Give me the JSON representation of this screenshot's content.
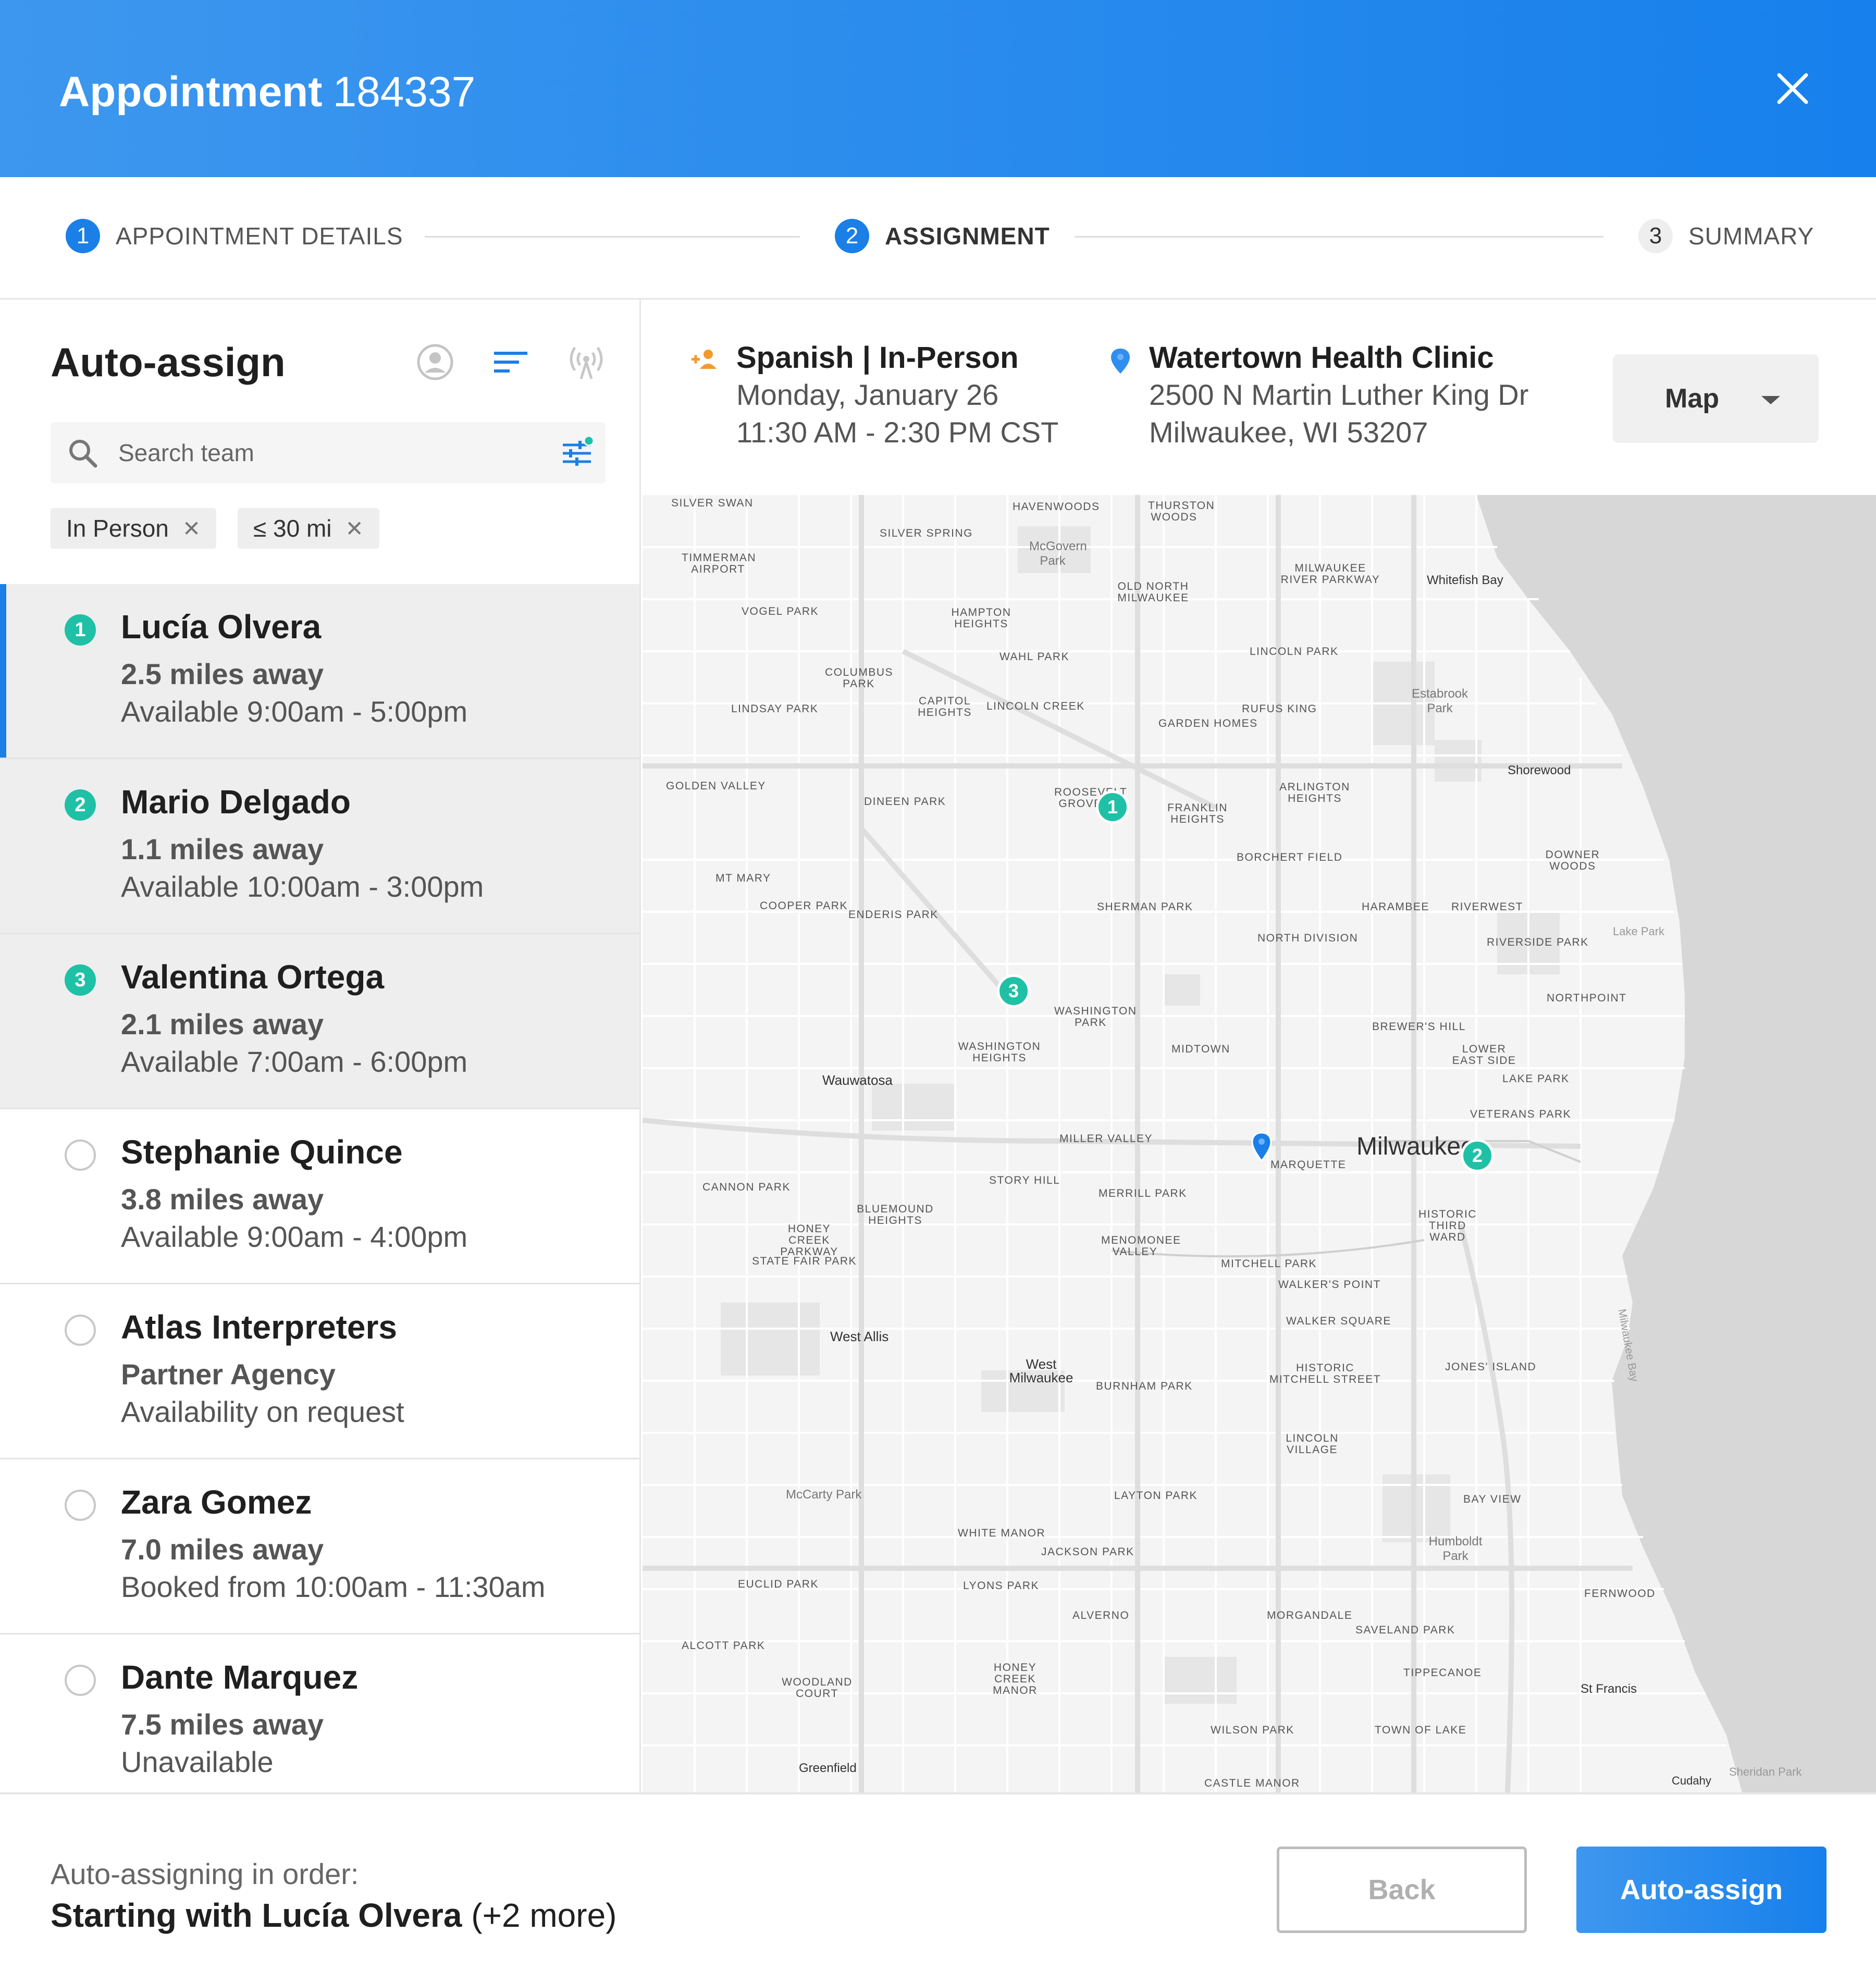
{
  "header": {
    "title_bold": "Appointment",
    "title_number": "184337",
    "close_icon": "close-icon"
  },
  "stepper": {
    "steps": [
      {
        "num": "1",
        "label": "APPOINTMENT DETAILS",
        "state": "done"
      },
      {
        "num": "2",
        "label": "ASSIGNMENT",
        "state": "active"
      },
      {
        "num": "3",
        "label": "SUMMARY",
        "state": "upcoming"
      }
    ]
  },
  "left": {
    "title": "Auto-assign",
    "tools": [
      "person-circle-icon",
      "sort-lines-icon",
      "broadcast-icon"
    ],
    "search": {
      "placeholder": "Search team",
      "value": ""
    },
    "filters": [
      {
        "label": "In Person"
      },
      {
        "label": "≤ 30 mi"
      }
    ],
    "list": [
      {
        "rank": "1",
        "name": "Lucía Olvera",
        "distance": "2.5 miles away",
        "availability": "Available 9:00am - 5:00pm",
        "selected": true
      },
      {
        "rank": "2",
        "name": "Mario Delgado",
        "distance": "1.1 miles away",
        "availability": "Available 10:00am - 3:00pm",
        "selected": true
      },
      {
        "rank": "3",
        "name": "Valentina Ortega",
        "distance": "2.1 miles away",
        "availability": "Available 7:00am - 6:00pm",
        "selected": true
      },
      {
        "rank": "",
        "name": "Stephanie Quince",
        "distance": "3.8 miles away",
        "availability": "Available 9:00am - 4:00pm",
        "selected": false
      },
      {
        "rank": "",
        "name": "Atlas Interpreters",
        "distance": "Partner Agency",
        "availability": "Availability on request",
        "selected": false
      },
      {
        "rank": "",
        "name": "Zara Gomez",
        "distance": "7.0 miles away",
        "availability": "Booked from 10:00am - 11:30am",
        "selected": false
      },
      {
        "rank": "",
        "name": "Dante Marquez",
        "distance": "7.5 miles away",
        "availability": "Unavailable",
        "selected": false
      }
    ]
  },
  "info": {
    "language": "Spanish | In-Person",
    "date": "Monday,  January 26",
    "time": "11:30 AM - 2:30 PM CST",
    "clinic": "Watertown Health Clinic",
    "address1": "2500 N Martin Luther King Dr",
    "address2": "Milwaukee, WI 53207",
    "view_select": "Map"
  },
  "map": {
    "neighborhoods": [
      "SILVER SWAN",
      "SILVER SPRING",
      "HAVENWOODS",
      "THURSTON WOODS",
      "TIMMERMAN AIRPORT",
      "McGovern Park",
      "OLD NORTH MILWAUKEE",
      "MILWAUKEE RIVER PARKWAY",
      "Whitefish Bay",
      "VOGEL PARK",
      "HAMPTON HEIGHTS",
      "LINCOLN PARK",
      "WAHL PARK",
      "COLUMBUS PARK",
      "CAPITOL HEIGHTS",
      "LINCOLN CREEK",
      "LINDSAY PARK",
      "RUFUS KING",
      "GARDEN HOMES",
      "Estabrook Park",
      "Shorewood",
      "GOLDEN VALLEY",
      "DINEEN PARK",
      "ROOSEVELT GROVE",
      "FRANKLIN HEIGHTS",
      "ARLINGTON HEIGHTS",
      "BORCHERT FIELD",
      "DOWNER WOODS",
      "MT MARY",
      "COOPER PARK",
      "ENDERIS PARK",
      "SHERMAN PARK",
      "HARAMBEE",
      "RIVERWEST",
      "NORTH DIVISION",
      "RIVERSIDE PARK",
      "Lake Park",
      "NORTHPOINT",
      "WASHINGTON PARK",
      "BREWER'S HILL",
      "WASHINGTON HEIGHTS",
      "MIDTOWN",
      "LOWER EAST SIDE",
      "LAKE PARK",
      "Wauwatosa",
      "VETERANS PARK",
      "MILLER VALLEY",
      "MARQUETTE",
      "Milwaukee",
      "CANNON PARK",
      "STORY HILL",
      "MERRILL PARK",
      "HISTORIC THIRD WARD",
      "BLUEMOUND HEIGHTS",
      "HONEY CREEK PARKWAY",
      "MENOMONEE VALLEY",
      "STATE FAIR PARK",
      "MITCHELL PARK",
      "WALKER'S POINT",
      "West Allis",
      "WALKER SQUARE",
      "West Milwaukee",
      "BURNHAM PARK",
      "HISTORIC MITCHELL STREET",
      "JONES' ISLAND",
      "Milwaukee Bay",
      "LINCOLN VILLAGE",
      "McCarty Park",
      "LAYTON PARK",
      "BAY VIEW",
      "WHITE MANOR",
      "JACKSON PARK",
      "Humboldt Park",
      "EUCLID PARK",
      "LYONS PARK",
      "FERNWOOD",
      "ALVERNO",
      "MORGANDALE",
      "SAVELAND PARK",
      "ALCOTT PARK",
      "HONEY CREEK MANOR",
      "WOODLAND COURT",
      "TIPPECANOE",
      "St Francis",
      "WILSON PARK",
      "TOWN OF LAKE",
      "Greenfield",
      "CASTLE MANOR",
      "Cudahy",
      "Sheridan Park"
    ],
    "markers": [
      {
        "num": "1"
      },
      {
        "num": "2"
      },
      {
        "num": "3"
      }
    ],
    "colors": {
      "marker": "#1ec1a5",
      "pin": "#1a7fe6",
      "water": "#d5d5d5"
    }
  },
  "footer": {
    "line1": "Auto-assigning in order:",
    "line2_bold": "Starting with Lucía Olvera",
    "line2_rest": " (+2 more)",
    "back_label": "Back",
    "auto_label": "Auto-assign"
  }
}
